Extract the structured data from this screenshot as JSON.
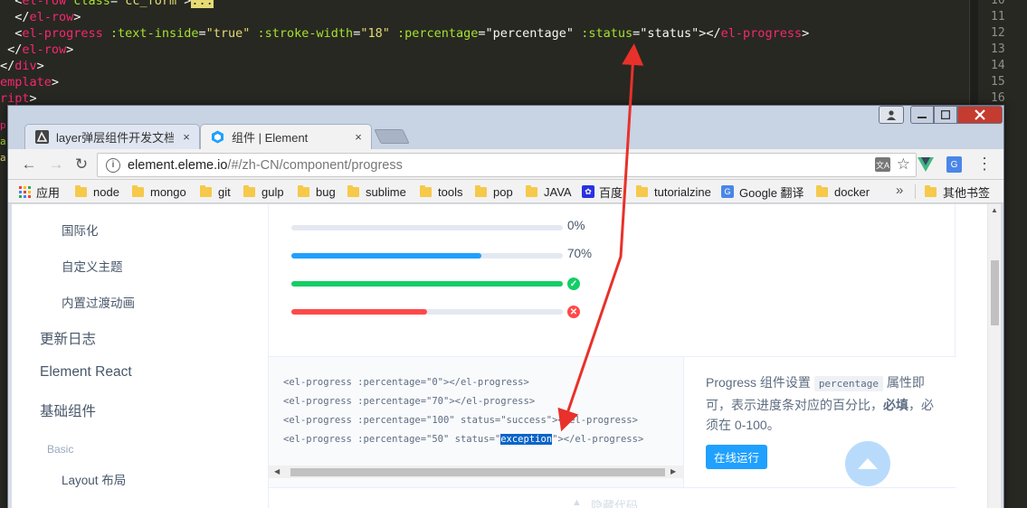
{
  "editor": {
    "lines": [
      [
        {
          "c": "tk-plain",
          "t": "  <"
        },
        {
          "c": "tk-tag",
          "t": "el-row"
        },
        {
          "c": "tk-attr",
          "t": " class"
        },
        {
          "c": "tk-plain",
          "t": "="
        },
        {
          "c": "tk-str",
          "t": "\"cc_form\""
        },
        {
          "c": "tk-plain",
          "t": ">"
        },
        {
          "c": "tk-hl",
          "t": "..."
        }
      ],
      [
        {
          "c": "tk-plain",
          "t": "  </"
        },
        {
          "c": "tk-tag",
          "t": "el-row"
        },
        {
          "c": "tk-plain",
          "t": ">"
        }
      ],
      [
        {
          "c": "tk-plain",
          "t": "  <"
        },
        {
          "c": "tk-tag",
          "t": "el-progress"
        },
        {
          "c": "tk-attr",
          "t": " :text-inside"
        },
        {
          "c": "tk-plain",
          "t": "="
        },
        {
          "c": "tk-str",
          "t": "\"true\""
        },
        {
          "c": "tk-attr",
          "t": " :stroke-width"
        },
        {
          "c": "tk-plain",
          "t": "="
        },
        {
          "c": "tk-str",
          "t": "\"18\""
        },
        {
          "c": "tk-attr",
          "t": " :percentage"
        },
        {
          "c": "tk-plain",
          "t": "="
        },
        {
          "c": "tk-plain",
          "t": "\"percentage\""
        },
        {
          "c": "tk-attr",
          "t": " :status"
        },
        {
          "c": "tk-plain",
          "t": "="
        },
        {
          "c": "tk-plain",
          "t": "\"status\""
        },
        {
          "c": "tk-plain",
          "t": "></"
        },
        {
          "c": "tk-tag",
          "t": "el-progress"
        },
        {
          "c": "tk-plain",
          "t": ">"
        }
      ],
      [
        {
          "c": "tk-plain",
          "t": " </"
        },
        {
          "c": "tk-tag",
          "t": "el-row"
        },
        {
          "c": "tk-plain",
          "t": ">"
        }
      ],
      [
        {
          "c": "tk-plain",
          "t": "</"
        },
        {
          "c": "tk-tag",
          "t": "div"
        },
        {
          "c": "tk-plain",
          "t": ">"
        }
      ],
      [
        {
          "c": "tk-tag",
          "t": "emplate"
        },
        {
          "c": "tk-plain",
          "t": ">"
        }
      ],
      [
        {
          "c": "tk-tag",
          "t": "ript"
        },
        {
          "c": "tk-plain",
          "t": ">"
        }
      ]
    ],
    "line_numbers": [
      "10",
      "11",
      "12",
      "13",
      "14",
      "15",
      "16"
    ]
  },
  "browser": {
    "tabs": [
      {
        "title": "layer弹层组件开发文档 -",
        "close": "×"
      },
      {
        "title": "组件 | Element",
        "close": "×"
      }
    ],
    "window_buttons": {
      "minimize": "▬",
      "maximize": "□",
      "close": "✕",
      "profile": "👤"
    },
    "nav": {
      "back": "←",
      "forward": "→",
      "reload": "↻"
    },
    "url": {
      "host": "element.eleme.io",
      "path": "/#/zh-CN/component/progress"
    },
    "bookmarks": [
      "应用",
      "node",
      "mongo",
      "git",
      "gulp",
      "bug",
      "sublime",
      "tools",
      "pop",
      "JAVA",
      "百度",
      "tutorialzine",
      "Google 翻译",
      "docker"
    ],
    "bookmarks_overflow": "»",
    "other_bookmarks": "其他书签"
  },
  "sidebar": {
    "sub_items": [
      "国际化",
      "自定义主题",
      "内置过渡动画"
    ],
    "main_items": [
      "更新日志",
      "Element React",
      "基础组件"
    ],
    "group_label": "Basic",
    "group_items": [
      "Layout 布局"
    ]
  },
  "demo": {
    "bars": [
      {
        "value": 0,
        "label": "0%",
        "color": "#20a0ff",
        "status": null
      },
      {
        "value": 70,
        "label": "70%",
        "color": "#20a0ff",
        "status": null
      },
      {
        "value": 100,
        "label": "",
        "color": "#13ce66",
        "status": "success",
        "icon": "✓"
      },
      {
        "value": 50,
        "label": "",
        "color": "#ff4949",
        "status": "exception",
        "icon": "✕"
      }
    ],
    "code": [
      {
        "before": "<el-progress :percentage=\"0\"></el-progress>",
        "hl": "",
        "after": ""
      },
      {
        "before": "<el-progress :percentage=\"70\"></el-progress>",
        "hl": "",
        "after": ""
      },
      {
        "before": "<el-progress :percentage=\"100\" status=\"success\"></el-progress>",
        "hl": "",
        "after": ""
      },
      {
        "before": "<el-progress :percentage=\"50\" status=\"",
        "hl": "exception",
        "after": "\"></el-progress>"
      }
    ],
    "description": {
      "p1": "Progress 组件设置",
      "code": "percentage",
      "p2": "属性即可，表示进度条对应的百分比，",
      "bold": "必填",
      "p3": "，必须在 0-100。"
    },
    "run_button": "在线运行",
    "hide_code": "隐藏代码"
  },
  "colors": {
    "primary": "#20a0ff",
    "success": "#13ce66",
    "danger": "#ff4949",
    "annotation_arrow": "#e8312a"
  }
}
